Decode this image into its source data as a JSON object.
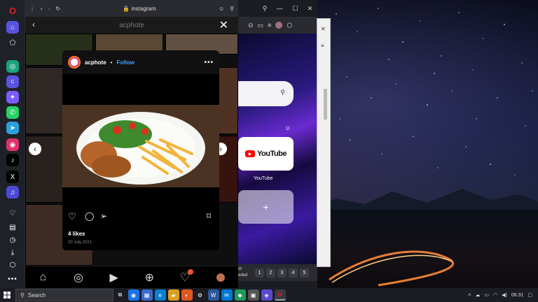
{
  "browser": {
    "url": "instagram",
    "nav": {
      "back": "‹",
      "forward": "›",
      "reload": "↻"
    }
  },
  "instagram": {
    "profile_title": "acphote",
    "post": {
      "username": "acphote",
      "separator": "•",
      "follow_label": "Follow",
      "likes": "4 likes",
      "date": "20 July 2021"
    }
  },
  "second_browser": {
    "youtube_label": "YouTube",
    "youtube_tile_text": "YouTube",
    "add_label": "+",
    "bottom_left_text": "ot\neded",
    "page_buttons": [
      "1",
      "2",
      "3",
      "4",
      "5"
    ]
  },
  "taskbar": {
    "search_placeholder": "Search",
    "time": "06:31"
  },
  "colors": {
    "opera_red": "#e0202a",
    "instagram_follow": "#3fa2ff",
    "youtube_red": "#ff0000"
  }
}
